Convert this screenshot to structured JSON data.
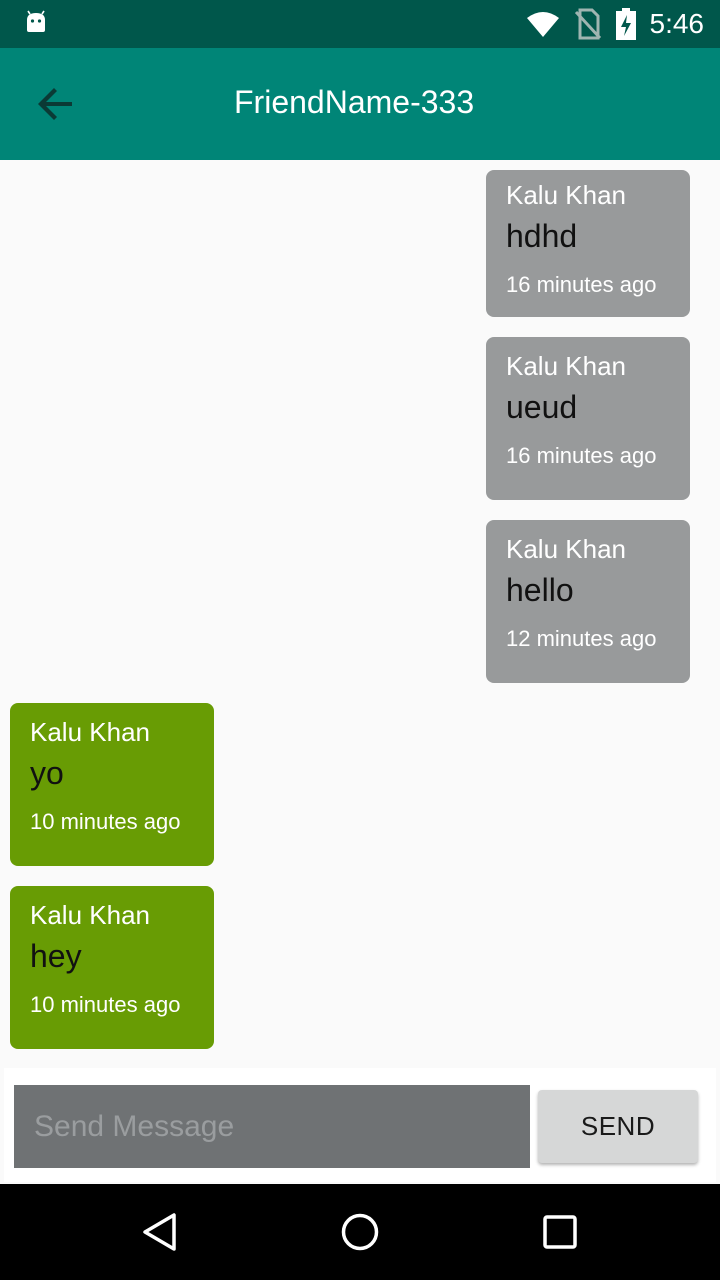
{
  "status_bar": {
    "time": "5:46",
    "icons": [
      "android-icon",
      "wifi-icon",
      "no-sim-icon",
      "battery-charging-icon"
    ]
  },
  "app_bar": {
    "title": "FriendName-333",
    "back_icon": "arrow-back-icon"
  },
  "messages": [
    {
      "type": "sent",
      "sender": "Kalu Khan",
      "text": "hdhd",
      "time": "16 minutes ago"
    },
    {
      "type": "sent",
      "sender": "Kalu Khan",
      "text": "ueud",
      "time": "16 minutes ago"
    },
    {
      "type": "sent",
      "sender": "Kalu Khan",
      "text": "hello",
      "time": "12 minutes ago"
    },
    {
      "type": "received",
      "sender": "Kalu Khan",
      "text": "yo",
      "time": "10 minutes ago"
    },
    {
      "type": "received",
      "sender": "Kalu Khan",
      "text": "hey",
      "time": "10 minutes ago"
    }
  ],
  "composer": {
    "placeholder": "Send Message",
    "value": "",
    "send_label": "SEND"
  },
  "nav_bar": {
    "icons": [
      "back-triangle-icon",
      "home-circle-icon",
      "recents-square-icon"
    ]
  },
  "colors": {
    "status_bar": "#00574b",
    "app_bar": "#008577",
    "sent_bubble": "#989a9b",
    "received_bubble": "#689c04",
    "input_bg": "#6f7274"
  }
}
